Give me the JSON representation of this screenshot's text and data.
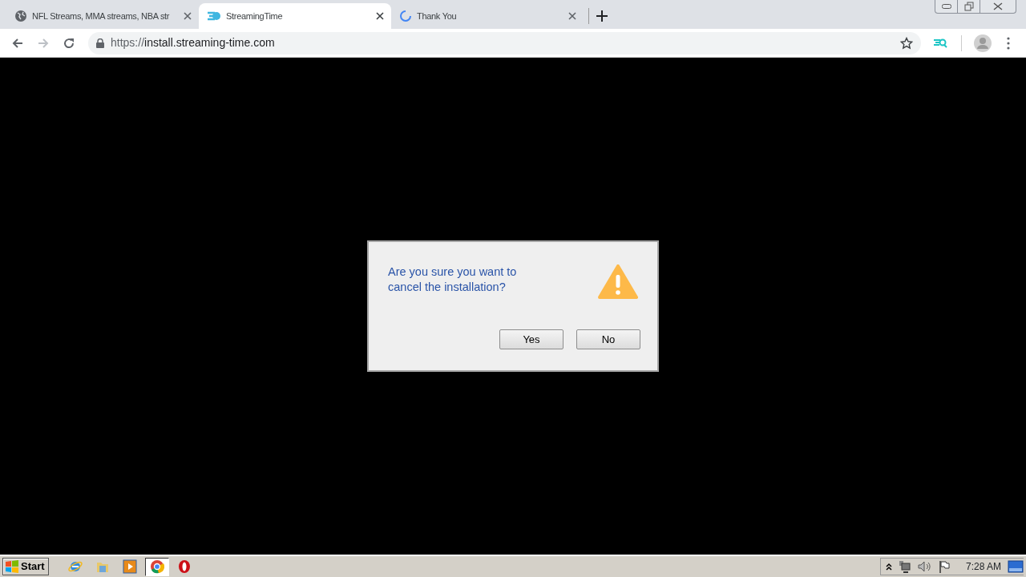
{
  "tabs": [
    {
      "title": "NFL Streams, MMA streams, NBA str",
      "kind": "site",
      "selected": false
    },
    {
      "title": "StreamingTime",
      "kind": "app",
      "selected": true
    },
    {
      "title": "Thank You",
      "kind": "loading",
      "selected": false
    }
  ],
  "address_bar": {
    "url_prefix": "https://",
    "url_host": "install.streaming-time.com"
  },
  "dialog": {
    "message": "Are you sure you want to cancel the installation?",
    "buttons": [
      "Yes",
      "No"
    ]
  },
  "taskbar": {
    "start": "Start",
    "apps": [
      {
        "kind": "ie",
        "selected": false
      },
      {
        "kind": "folder",
        "selected": false
      },
      {
        "kind": "media",
        "selected": false
      },
      {
        "kind": "chrome",
        "selected": true
      },
      {
        "kind": "opera",
        "selected": false
      }
    ],
    "clock": "7:28 AM"
  }
}
